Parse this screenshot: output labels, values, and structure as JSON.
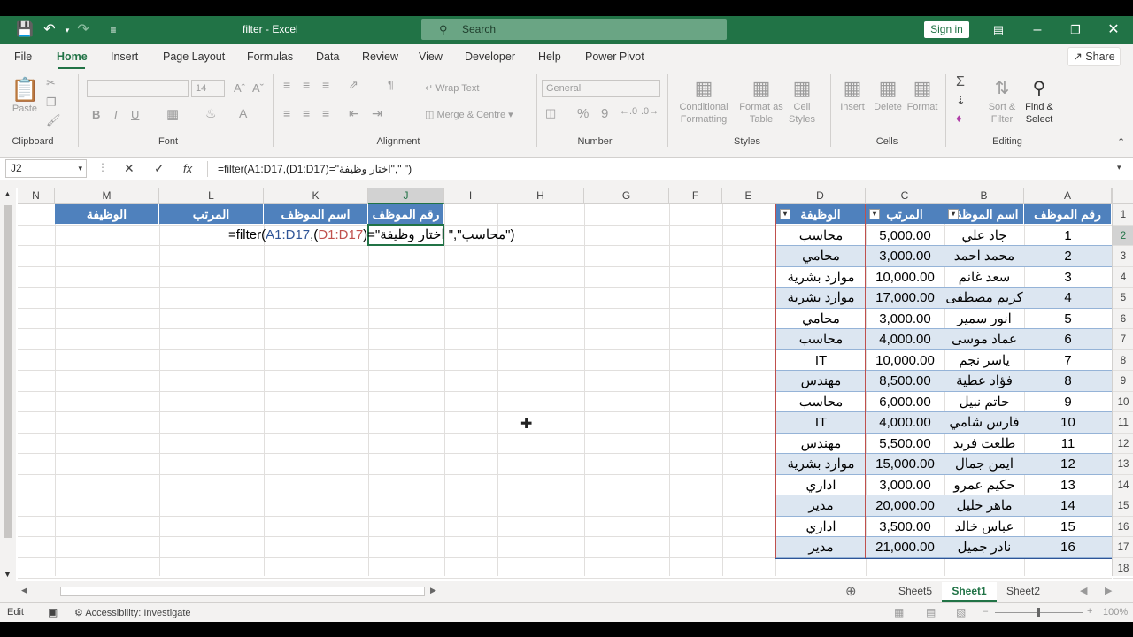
{
  "titlebar": {
    "title": "filter  -  Excel",
    "search_placeholder": "Search",
    "signin": "Sign in"
  },
  "menu": {
    "items": [
      "File",
      "Home",
      "Insert",
      "Page Layout",
      "Formulas",
      "Data",
      "Review",
      "View",
      "Developer",
      "Help",
      "Power Pivot"
    ],
    "share": "Share"
  },
  "ribbon": {
    "clipboard": {
      "label": "Clipboard",
      "paste": "Paste"
    },
    "font": {
      "label": "Font",
      "size": "14",
      "bold": "B",
      "italic": "I",
      "underline": "U"
    },
    "alignment": {
      "label": "Alignment",
      "wrap": "Wrap Text",
      "merge": "Merge & Centre"
    },
    "number": {
      "label": "Number",
      "format": "General",
      "percent": "%",
      "comma": "9"
    },
    "styles": {
      "label": "Styles",
      "conditional": "Conditional Formatting",
      "format_table": "Format as Table",
      "cell_styles": "Cell Styles"
    },
    "cells": {
      "label": "Cells",
      "insert": "Insert",
      "delete": "Delete",
      "format": "Format"
    },
    "editing": {
      "label": "Editing",
      "sort": "Sort & Filter",
      "find": "Find & Select"
    }
  },
  "formula_bar": {
    "name_box": "J2",
    "formula": "=filter(A1:D17,(D1:D17)=\"اختار وظيفة\",\" \")"
  },
  "columns": [
    "N",
    "M",
    "L",
    "K",
    "J",
    "I",
    "H",
    "G",
    "F",
    "E",
    "D",
    "C",
    "B",
    "A"
  ],
  "rows": [
    "1",
    "2",
    "3",
    "4",
    "5",
    "6",
    "7",
    "8",
    "9",
    "10",
    "11",
    "12",
    "13",
    "14",
    "15",
    "16",
    "17",
    "18"
  ],
  "output_headers": {
    "m": "الوظيفة",
    "l": "المرتب",
    "k": "اسم الموظف",
    "j": "رقم الموظف"
  },
  "editing_text": {
    "prefix": "=filter(",
    "range1": "A1:D17",
    "comma": ",(",
    "range2": "D1:D17",
    "rest": ")=\"محاسب\",\" اختار وظيفة\")"
  },
  "table": {
    "headers": [
      "رقم الموظف",
      "اسم الموظف",
      "المرتب",
      "الوظيفة"
    ],
    "rows": [
      [
        "1",
        "جاد علي",
        "5,000.00",
        "محاسب"
      ],
      [
        "2",
        "محمد احمد",
        "3,000.00",
        "محامي"
      ],
      [
        "3",
        "سعد غانم",
        "10,000.00",
        "موارد بشرية"
      ],
      [
        "4",
        "كريم مصطفى",
        "17,000.00",
        "موارد بشرية"
      ],
      [
        "5",
        "انور سمير",
        "3,000.00",
        "محامي"
      ],
      [
        "6",
        "عماد موسى",
        "4,000.00",
        "محاسب"
      ],
      [
        "7",
        "ياسر نجم",
        "10,000.00",
        "IT"
      ],
      [
        "8",
        "فؤاد عطية",
        "8,500.00",
        "مهندس"
      ],
      [
        "9",
        "حاتم نبيل",
        "6,000.00",
        "محاسب"
      ],
      [
        "10",
        "فارس شامي",
        "4,000.00",
        "IT"
      ],
      [
        "11",
        "طلعت فريد",
        "5,500.00",
        "مهندس"
      ],
      [
        "12",
        "ايمن جمال",
        "15,000.00",
        "موارد بشرية"
      ],
      [
        "13",
        "حكيم عمرو",
        "3,000.00",
        "اداري"
      ],
      [
        "14",
        "ماهر خليل",
        "20,000.00",
        "مدير"
      ],
      [
        "15",
        "عباس خالد",
        "3,500.00",
        "اداري"
      ],
      [
        "16",
        "نادر جميل",
        "21,000.00",
        "مدير"
      ]
    ]
  },
  "sheets": [
    "Sheet5",
    "Sheet1",
    "Sheet2"
  ],
  "status": {
    "mode": "Edit",
    "accessibility": "Accessibility: Investigate",
    "zoom": "100%"
  },
  "colors": {
    "excel_green": "#217346",
    "table_header": "#4f81bd",
    "band": "#dce6f1"
  }
}
